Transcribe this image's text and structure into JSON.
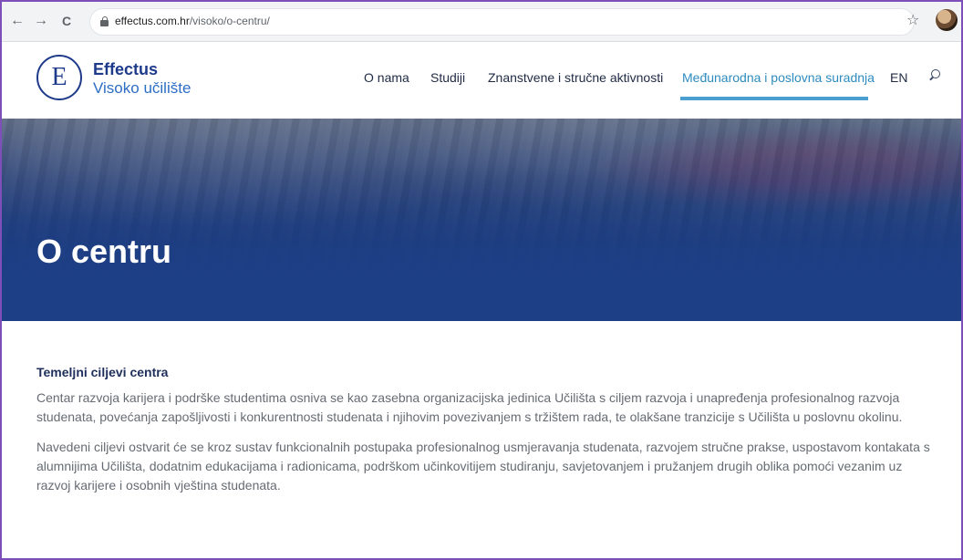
{
  "browser": {
    "url_host": "effectus.com.hr",
    "url_path": "/visoko/o-centru/",
    "back_icon": "←",
    "forward_icon": "→",
    "reload_icon": "C",
    "star_icon": "☆"
  },
  "logo": {
    "mark": "E",
    "title": "Effectus",
    "subtitle": "Visoko učilište"
  },
  "nav": {
    "items": [
      {
        "label": "O nama"
      },
      {
        "label": "Studiji"
      },
      {
        "label": "Znanstvene i stručne aktivnosti"
      },
      {
        "label": "Međunarodna i poslovna suradnja"
      },
      {
        "label": "EN"
      }
    ],
    "active_index": 3
  },
  "hero": {
    "title": "O centru"
  },
  "content": {
    "heading": "Temeljni ciljevi centra",
    "paragraphs": [
      "Centar razvoja karijera i podrške studentima osniva se kao zasebna organizacijska jedinica Učilišta s ciljem razvoja i unapređenja profesionalnog razvoja studenata, povećanja zapošljivosti i konkurentnosti studenata i njihovim povezivanjem s tržištem rada, te olakšane tranzicije s Učilišta u poslovnu okolinu.",
      "Navedeni ciljevi ostvarit će se kroz sustav funkcionalnih postupaka profesionalnog usmjeravanja studenata, razvojem stručne prakse, uspostavom kontakata s alumnijima Učilišta, dodatnim edukacijama i radionicama, podrškom učinkovitijem studiranju, savjetovanjem i pružanjem drugih oblika pomoći vezanim uz razvoj karijere i osobnih vještina studenata."
    ]
  },
  "colors": {
    "brand": "#1e3a8a",
    "accent": "#4a9fd0",
    "hero": "#1d3f86",
    "frame": "#7e4fb8"
  }
}
